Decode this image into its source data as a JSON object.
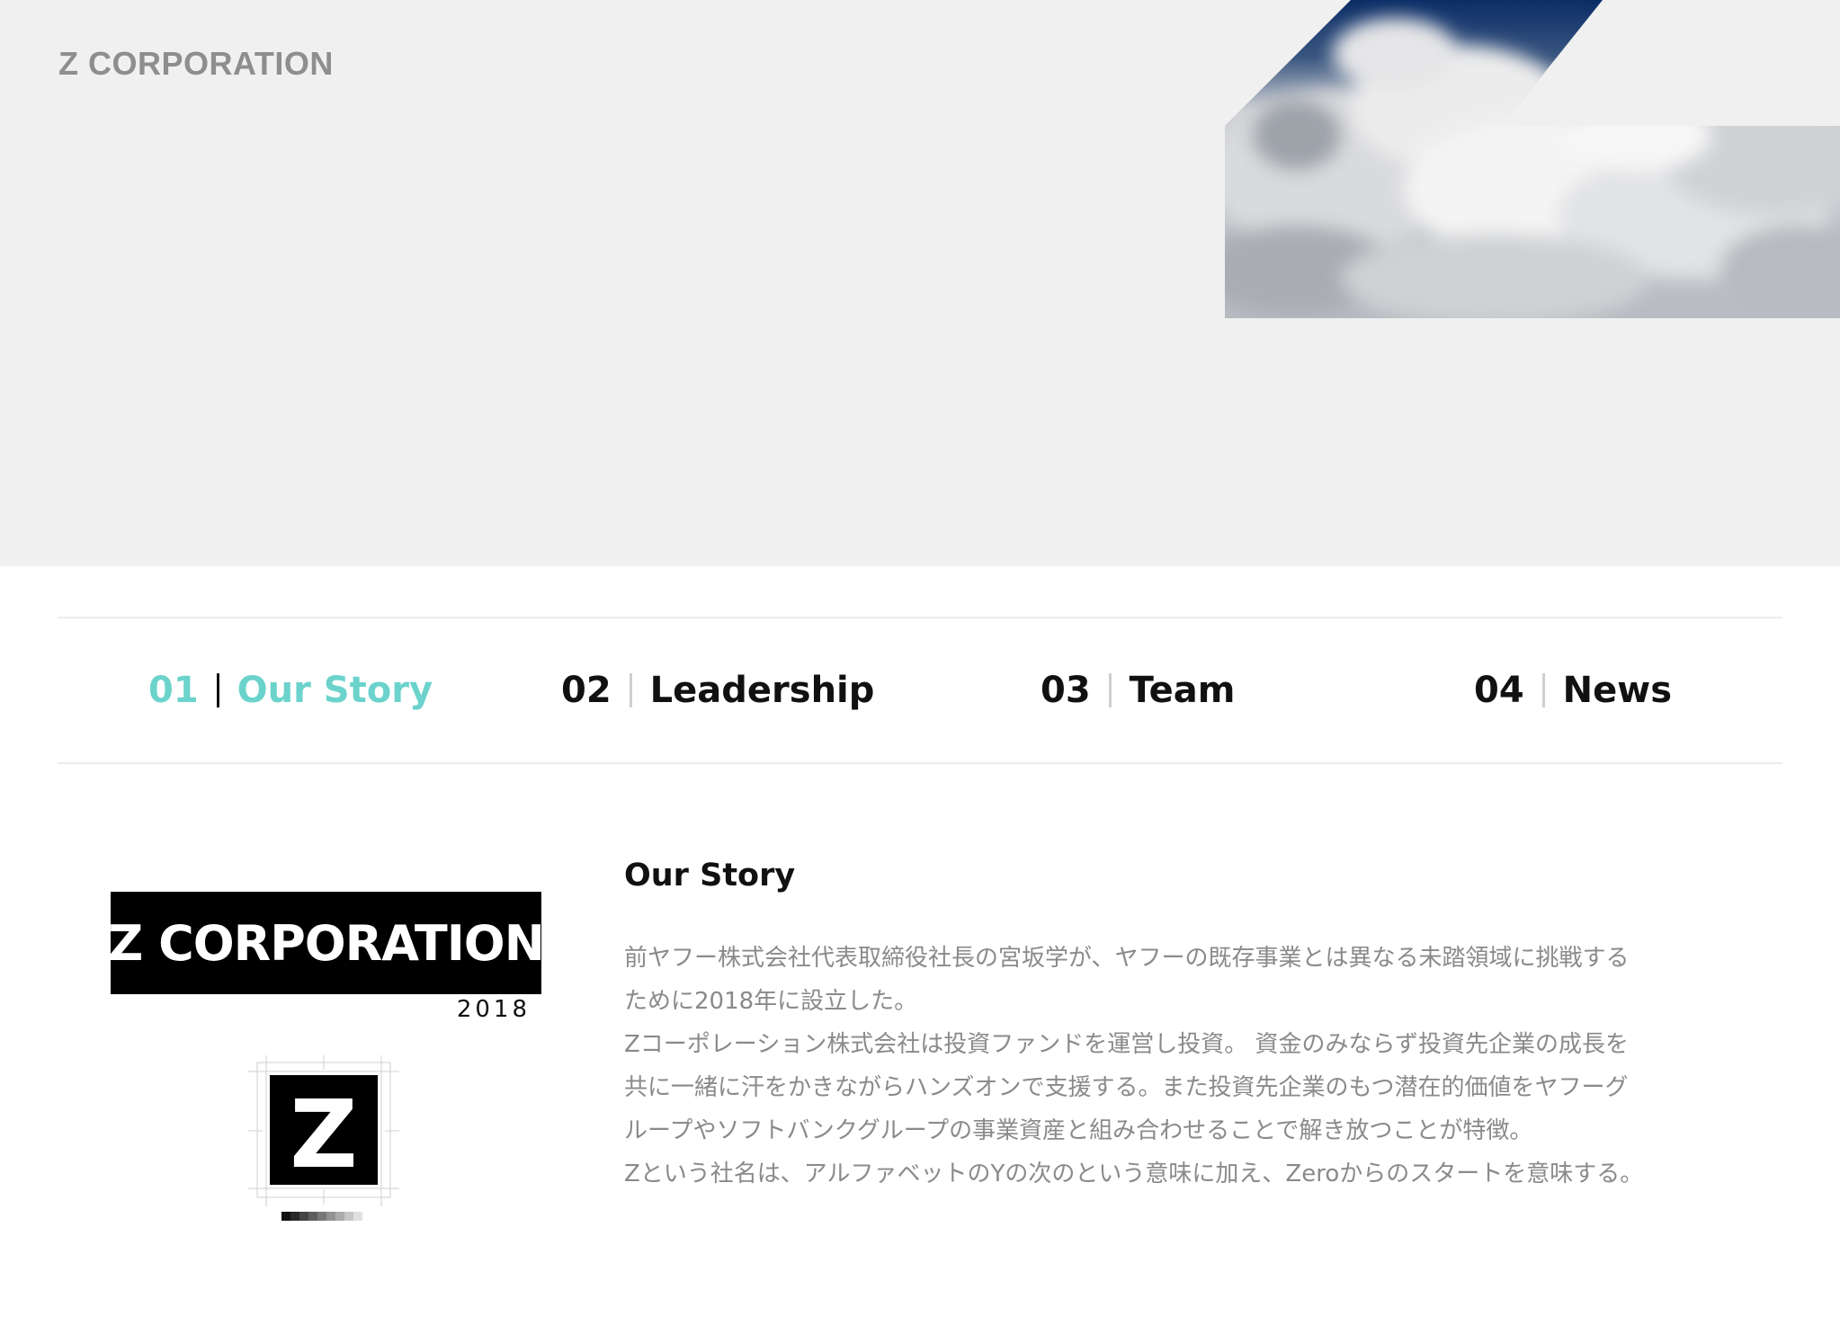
{
  "header": {
    "brand": "Z CORPORATION"
  },
  "tabs": [
    {
      "num": "01",
      "label": "Our Story",
      "active": true
    },
    {
      "num": "02",
      "label": "Leadership",
      "active": false
    },
    {
      "num": "03",
      "label": "Team",
      "active": false
    },
    {
      "num": "04",
      "label": "News",
      "active": false
    }
  ],
  "logo": {
    "wordmark": "Z CORPORATION",
    "year": "2018",
    "mark_letter": "Z"
  },
  "story": {
    "title": "Our Story",
    "lines": [
      "前ヤフー株式会社代表取締役社長の宮坂学が、ヤフーの既存事業とは異なる未踏領域に挑戦する",
      "ために2018年に設立した。",
      "Zコーポレーション株式会社は投資ファンドを運営し投資。 資金のみならず投資先企業の成長を",
      "共に一緒に汗をかきながらハンズオンで支援する。また投資先企業のもつ潜在的価値をヤフーグ",
      "ループやソフトバンクグループの事業資産と組み合わせることで解き放つことが特徴。",
      "Zという社名は、アルファベットのYの次のという意味に加え、Zeroからのスタートを意味する。"
    ]
  },
  "colors": {
    "accent": "#6bd3cc",
    "hero_bg": "#f0f0f0",
    "text_dark": "#111111",
    "text_muted": "#8a8a8a",
    "sky_blue": "#0b2d66"
  }
}
